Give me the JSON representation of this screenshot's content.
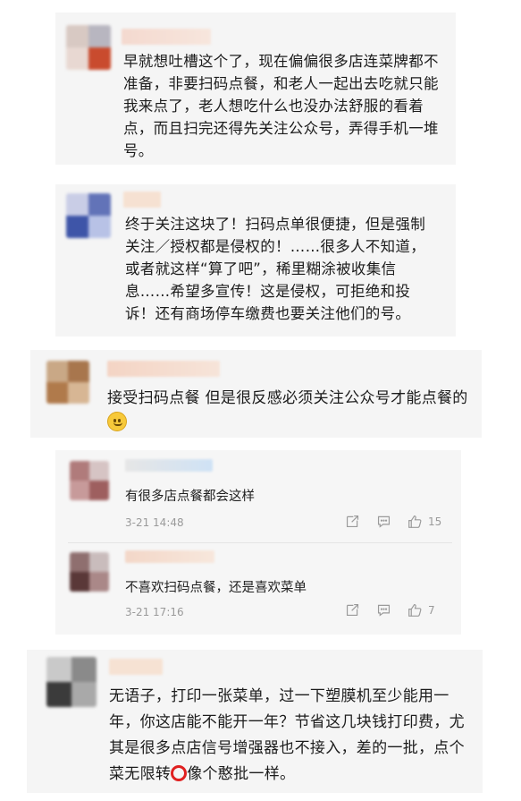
{
  "comments": [
    {
      "text": "早就想吐槽这个了，现在偏偏很多店连菜牌都不准备，非要扫码点餐，和老人一起出去吃就只能我来点了，老人想吃什么也没办法舒服的看着点，而且扫完还得先关注公众号，弄得手机一堆号。"
    },
    {
      "text": "终于关注这块了！扫码点单很便捷，但是强制关注／授权都是侵权的！……很多人不知道，或者就这样“算了吧”，稀里糊涂被收集信息……希望多宣传！这是侵权，可拒绝和投诉！还有商场停车缴费也要关注他们的号。"
    },
    {
      "text": "接受扫码点餐 但是很反感必须关注公众号才能点餐的",
      "emoji": "slightly-smiling-face-icon"
    },
    {
      "text_part1": "无语子，打印一张菜单，过一下塑膜机至少能用一年，你这店能不能开一年？节省这几块钱打印费，尤其是很多点店信号增强器也不接入，差的一批，点个菜无限转",
      "text_part2": "像个憨批一样。",
      "glyph": "red-ring-icon"
    }
  ],
  "replies": [
    {
      "text": "有很多店点餐都会这样",
      "time": "3-21 14:48",
      "likes": "15"
    },
    {
      "text": "不喜欢扫码点餐，还是喜欢菜单",
      "time": "3-21 17:16",
      "likes": "7"
    }
  ]
}
